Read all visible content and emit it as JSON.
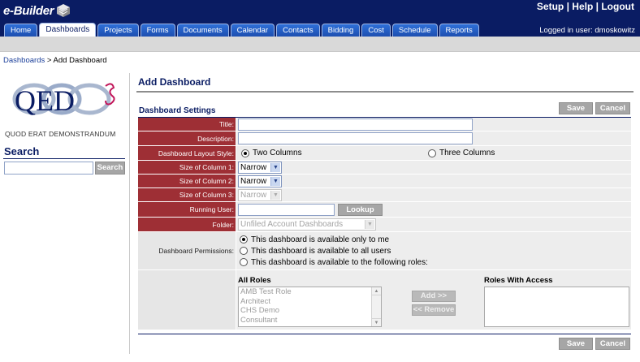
{
  "header": {
    "brand": "e-Builder",
    "links": [
      "Setup",
      "Help",
      "Logout"
    ],
    "logged_in": "Logged in user: dmoskowitz",
    "tabs": [
      {
        "label": "Home",
        "active": false
      },
      {
        "label": "Dashboards",
        "active": true
      },
      {
        "label": "Projects",
        "active": false
      },
      {
        "label": "Forms",
        "active": false
      },
      {
        "label": "Documents",
        "active": false
      },
      {
        "label": "Calendar",
        "active": false
      },
      {
        "label": "Contacts",
        "active": false
      },
      {
        "label": "Bidding",
        "active": false
      },
      {
        "label": "Cost",
        "active": false
      },
      {
        "label": "Schedule",
        "active": false
      },
      {
        "label": "Reports",
        "active": false
      }
    ]
  },
  "breadcrumb": {
    "parent": "Dashboards",
    "sep": " > ",
    "current": "Add Dashboard"
  },
  "sidebar": {
    "logo_text": "QED",
    "logo_subtitle": "QUOD ERAT DEMONSTRANDUM",
    "search_title": "Search",
    "search_value": "",
    "search_button": "Search"
  },
  "main": {
    "title": "Add Dashboard",
    "section": "Dashboard Settings",
    "save": "Save",
    "cancel": "Cancel",
    "fields": {
      "title_label": "Title:",
      "title_value": "",
      "description_label": "Description:",
      "description_value": "",
      "layout_label": "Dashboard Layout Style:",
      "layout_two": "Two Columns",
      "layout_three": "Three Columns",
      "layout_selected": "two",
      "col1_label": "Size of Column 1:",
      "col1_value": "Narrow",
      "col2_label": "Size of Column 2:",
      "col2_value": "Narrow",
      "col3_label": "Size of Column 3:",
      "col3_value": "Narrow",
      "running_user_label": "Running User:",
      "running_user_value": "",
      "lookup": "Lookup",
      "folder_label": "Folder:",
      "folder_value": "Unfiled Account Dashboards",
      "permissions_label": "Dashboard Permissions:",
      "perm_only_me": "This dashboard is available only to me",
      "perm_all": "This dashboard is available to all users",
      "perm_roles": "This dashboard is available to the following roles:",
      "perm_selected": "only_me"
    },
    "roles": {
      "all_roles_title": "All Roles",
      "all_roles": [
        "AMB Test Role",
        "Architect",
        "CHS Demo",
        "Consultant"
      ],
      "add": "Add >>",
      "remove": "<< Remove",
      "with_access_title": "Roles With Access",
      "with_access": []
    }
  },
  "colors": {
    "navy": "#0a1c63",
    "label_red": "#9e2f35",
    "tab_blue": "#1d4fb0",
    "grey_button": "#a6a6a6"
  }
}
